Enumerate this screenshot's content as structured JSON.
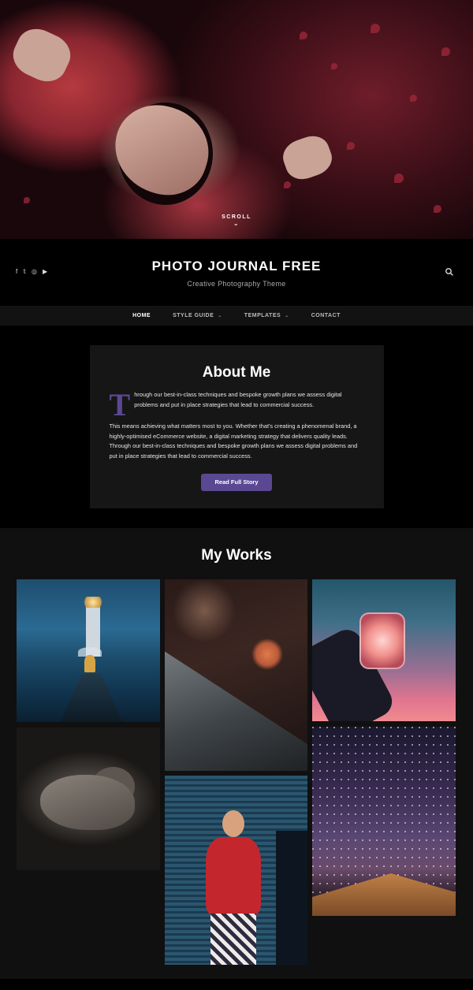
{
  "hero": {
    "scroll_label": "SCROLL",
    "scroll_icon": "chevron-down-icon"
  },
  "header": {
    "social_icons": [
      "facebook-icon",
      "twitter-icon",
      "instagram-icon",
      "youtube-icon"
    ],
    "site_title": "PHOTO JOURNAL FREE",
    "tagline": "Creative Photography Theme",
    "search_icon": "search-icon"
  },
  "nav": {
    "items": [
      {
        "label": "HOME",
        "active": true,
        "has_dropdown": false
      },
      {
        "label": "STYLE GUIDE",
        "active": false,
        "has_dropdown": true
      },
      {
        "label": "TEMPLATES",
        "active": false,
        "has_dropdown": true
      },
      {
        "label": "CONTACT",
        "active": false,
        "has_dropdown": false
      }
    ]
  },
  "about": {
    "heading": "About Me",
    "dropcap": "T",
    "paragraph1_rest": "hrough our best-in-class techniques and bespoke growth plans we assess digital problems and put in place strategies that lead to commercial success.",
    "paragraph2": "This means achieving what matters most to you. Whether that's creating a phenomenal brand, a highly-optimised eCommerce website, a digital marketing strategy that delivers quality leads. Through our best-in-class techniques and bespoke growth plans we assess digital problems and put in place strategies that lead to commercial success.",
    "button_label": "Read Full Story"
  },
  "works": {
    "heading": "My Works"
  },
  "colors": {
    "accent": "#5a4893",
    "background": "#000000",
    "card": "#161616",
    "nav_bar": "#121212"
  }
}
